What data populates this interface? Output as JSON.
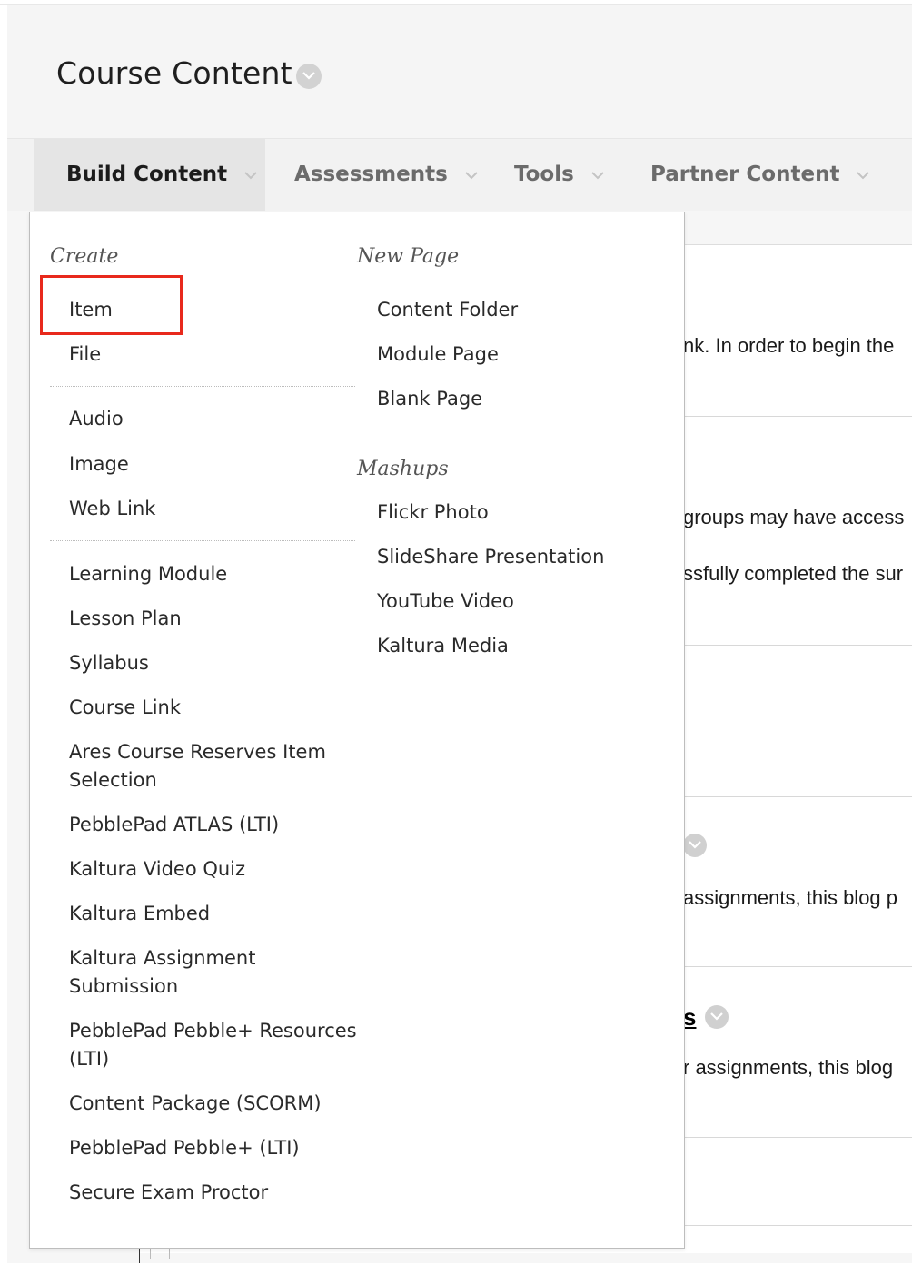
{
  "header": {
    "title": "Course Content"
  },
  "action_bar": {
    "build_content": "Build Content",
    "assessments": "Assessments",
    "tools": "Tools",
    "partner_content": "Partner Content"
  },
  "dropdown": {
    "create_heading": "Create",
    "create_group1": [
      "Item",
      "File"
    ],
    "create_group2": [
      "Audio",
      "Image",
      "Web Link"
    ],
    "create_group3": [
      "Learning Module",
      "Lesson Plan",
      "Syllabus",
      "Course Link",
      "Ares Course Reserves Item Selection",
      "PebblePad ATLAS (LTI)",
      "Kaltura Video Quiz",
      "Kaltura Embed",
      "Kaltura Assignment Submission",
      "PebblePad Pebble+ Resources (LTI)",
      "Content Package (SCORM)",
      "PebblePad Pebble+ (LTI)",
      "Secure Exam Proctor"
    ],
    "new_page_heading": "New Page",
    "new_page_items": [
      "Content Folder",
      "Module Page",
      "Blank Page"
    ],
    "mashups_heading": "Mashups",
    "mashups_items": [
      "Flickr Photo",
      "SlideShare Presentation",
      "YouTube Video",
      "Kaltura Media"
    ]
  },
  "background_content": {
    "snippet_1": "nk. In order to begin the",
    "snippet_2": "groups may have access",
    "snippet_3": "ssfully completed the sur",
    "snippet_4": "assignments, this blog p",
    "link_fragment": "s",
    "snippet_5": "r assignments, this blog"
  },
  "colors": {
    "highlight": "#e8291c",
    "header_bg": "#f5f5f5",
    "active_tab_bg": "#e5e5e5"
  }
}
